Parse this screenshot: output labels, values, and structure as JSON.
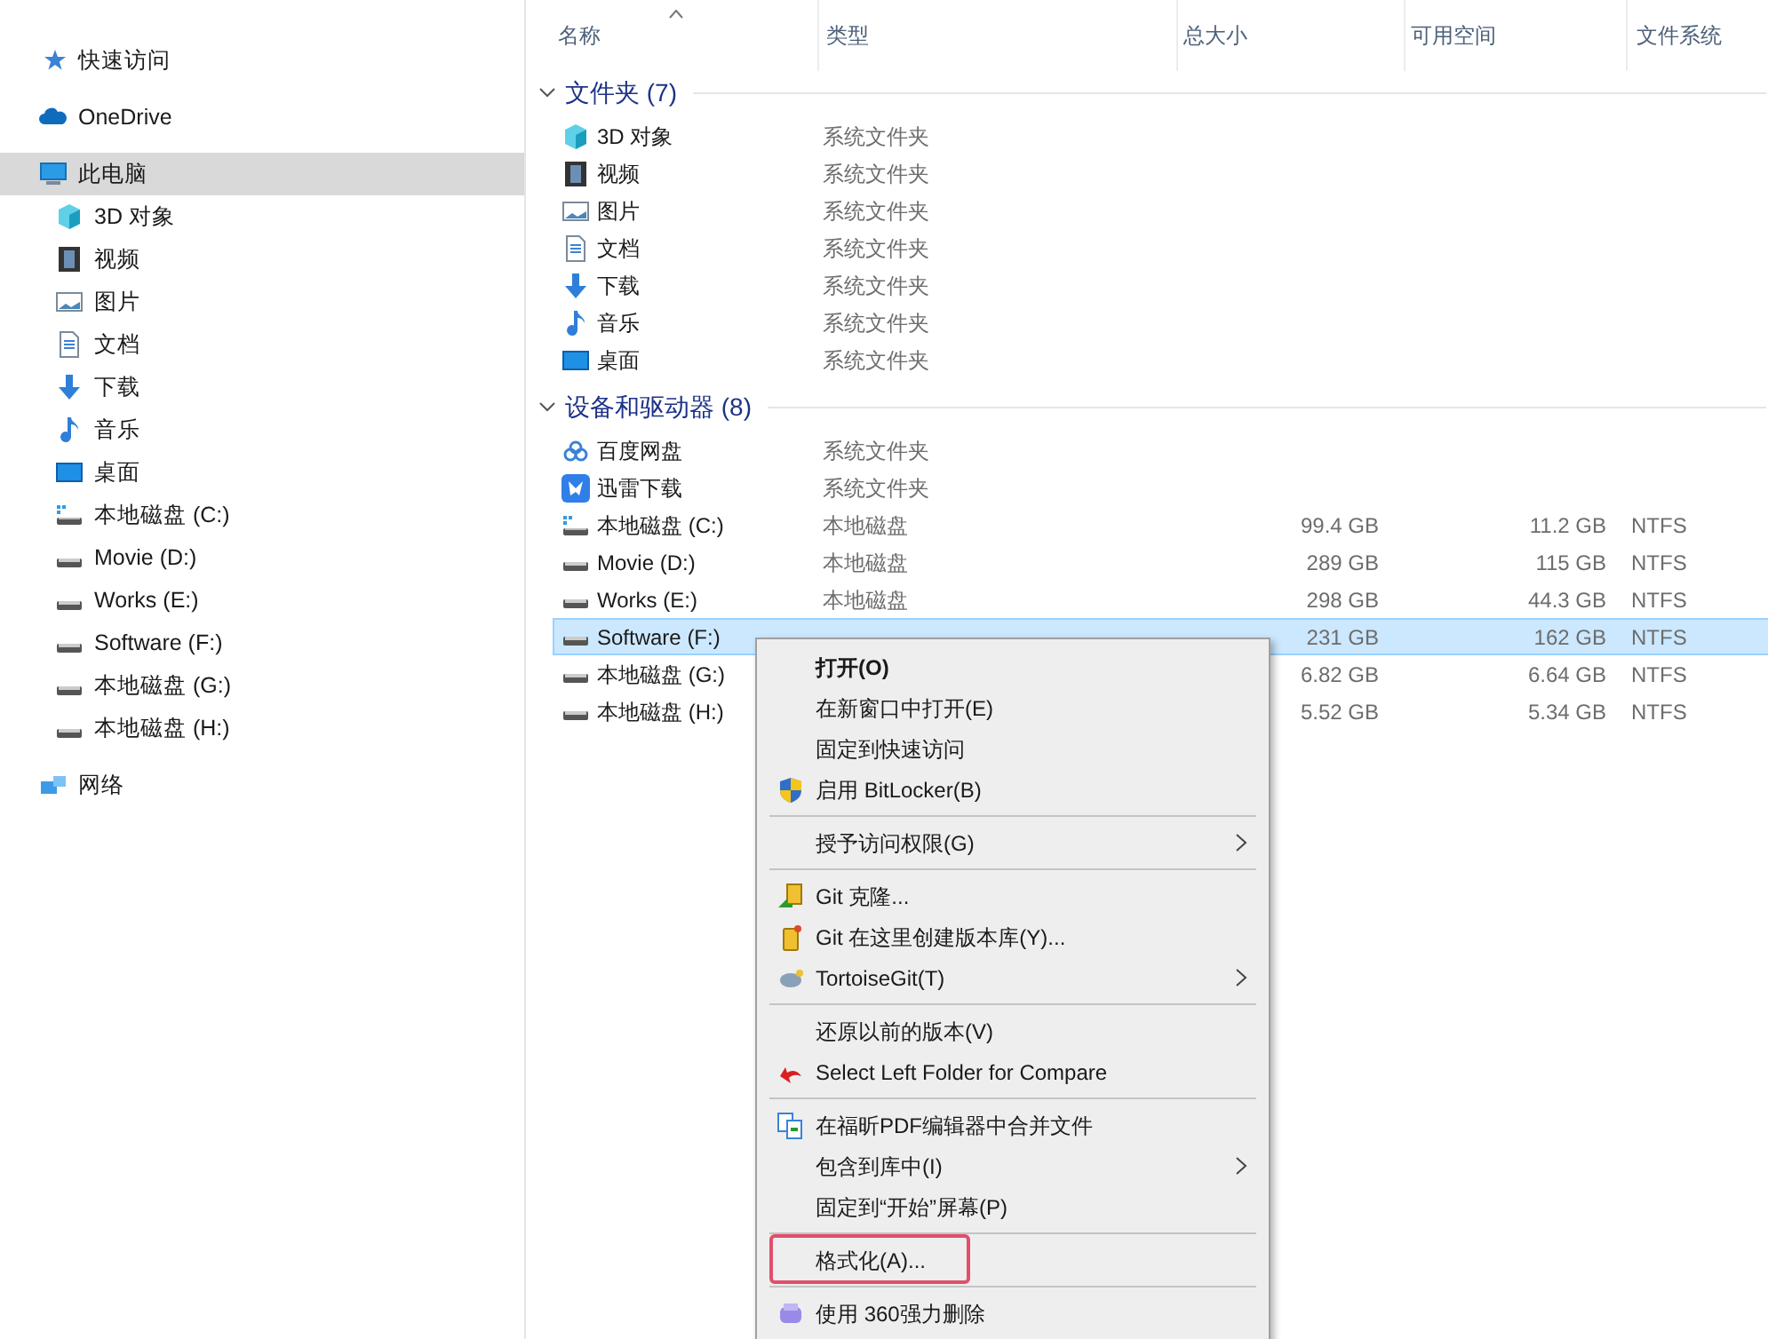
{
  "sidebar": {
    "items": [
      {
        "label": "快速访问",
        "selected": false
      },
      {
        "label": "OneDrive",
        "selected": false
      },
      {
        "label": "此电脑",
        "selected": true,
        "children": [
          {
            "label": "3D 对象",
            "selected": false
          },
          {
            "label": "视频",
            "selected": false
          },
          {
            "label": "图片",
            "selected": false
          },
          {
            "label": "文档",
            "selected": false
          },
          {
            "label": "下载",
            "selected": false
          },
          {
            "label": "音乐",
            "selected": false
          },
          {
            "label": "桌面",
            "selected": false
          },
          {
            "label": "本地磁盘 (C:)",
            "selected": false
          },
          {
            "label": "Movie (D:)",
            "selected": false
          },
          {
            "label": "Works (E:)",
            "selected": false
          },
          {
            "label": "Software (F:)",
            "selected": false
          },
          {
            "label": "本地磁盘 (G:)",
            "selected": false
          },
          {
            "label": "本地磁盘 (H:)",
            "selected": false
          }
        ]
      },
      {
        "label": "网络",
        "selected": false
      }
    ]
  },
  "table": {
    "columns": [
      "名称",
      "类型",
      "总大小",
      "可用空间",
      "文件系统"
    ],
    "groups": [
      {
        "title": "文件夹 (7)",
        "expanded": true,
        "rows": [
          {
            "name": "3D 对象",
            "type": "系统文件夹",
            "selected": false
          },
          {
            "name": "视频",
            "type": "系统文件夹",
            "selected": false
          },
          {
            "name": "图片",
            "type": "系统文件夹",
            "selected": false
          },
          {
            "name": "文档",
            "type": "系统文件夹",
            "selected": false
          },
          {
            "name": "下载",
            "type": "系统文件夹",
            "selected": false
          },
          {
            "name": "音乐",
            "type": "系统文件夹",
            "selected": false
          },
          {
            "name": "桌面",
            "type": "系统文件夹",
            "selected": false
          }
        ]
      },
      {
        "title": "设备和驱动器 (8)",
        "expanded": true,
        "rows": [
          {
            "name": "百度网盘",
            "type": "系统文件夹",
            "selected": false
          },
          {
            "name": "迅雷下载",
            "type": "系统文件夹",
            "selected": false
          },
          {
            "name": "本地磁盘 (C:)",
            "type": "本地磁盘",
            "total": "99.4 GB",
            "free": "11.2 GB",
            "fs": "NTFS",
            "selected": false
          },
          {
            "name": "Movie (D:)",
            "type": "本地磁盘",
            "total": "289 GB",
            "free": "115 GB",
            "fs": "NTFS",
            "selected": false
          },
          {
            "name": "Works (E:)",
            "type": "本地磁盘",
            "total": "298 GB",
            "free": "44.3 GB",
            "fs": "NTFS",
            "selected": false
          },
          {
            "name": "Software (F:)",
            "total": "231 GB",
            "free": "162 GB",
            "fs": "NTFS",
            "selected": true
          },
          {
            "name": "本地磁盘 (G:)",
            "total": "6.82 GB",
            "free": "6.64 GB",
            "fs": "NTFS",
            "selected": false
          },
          {
            "name": "本地磁盘 (H:)",
            "total": "5.52 GB",
            "free": "5.34 GB",
            "fs": "NTFS",
            "selected": false
          }
        ]
      }
    ]
  },
  "context_menu": {
    "items": [
      {
        "kind": "item",
        "label": "打开(O)",
        "bold": true,
        "submenu": false,
        "highlighted": false
      },
      {
        "kind": "item",
        "label": "在新窗口中打开(E)",
        "bold": false,
        "submenu": false,
        "highlighted": false
      },
      {
        "kind": "item",
        "label": "固定到快速访问",
        "bold": false,
        "submenu": false,
        "highlighted": false
      },
      {
        "kind": "item",
        "label": "启用 BitLocker(B)",
        "bold": false,
        "submenu": false,
        "highlighted": false
      },
      {
        "kind": "separator"
      },
      {
        "kind": "item",
        "label": "授予访问权限(G)",
        "bold": false,
        "submenu": true,
        "highlighted": false
      },
      {
        "kind": "separator"
      },
      {
        "kind": "item",
        "label": "Git 克隆...",
        "bold": false,
        "submenu": false,
        "highlighted": false
      },
      {
        "kind": "item",
        "label": "Git 在这里创建版本库(Y)...",
        "bold": false,
        "submenu": false,
        "highlighted": false
      },
      {
        "kind": "item",
        "label": "TortoiseGit(T)",
        "bold": false,
        "submenu": true,
        "highlighted": false
      },
      {
        "kind": "separator"
      },
      {
        "kind": "item",
        "label": "还原以前的版本(V)",
        "bold": false,
        "submenu": false,
        "highlighted": false
      },
      {
        "kind": "item",
        "label": "Select Left Folder for Compare",
        "bold": false,
        "submenu": false,
        "highlighted": false
      },
      {
        "kind": "separator"
      },
      {
        "kind": "item",
        "label": "在福昕PDF编辑器中合并文件",
        "bold": false,
        "submenu": false,
        "highlighted": false
      },
      {
        "kind": "item",
        "label": "包含到库中(I)",
        "bold": false,
        "submenu": true,
        "highlighted": false
      },
      {
        "kind": "item",
        "label": "固定到“开始”屏幕(P)",
        "bold": false,
        "submenu": false,
        "highlighted": false
      },
      {
        "kind": "separator"
      },
      {
        "kind": "item",
        "label": "格式化(A)...",
        "bold": false,
        "submenu": false,
        "highlighted": true
      },
      {
        "kind": "separator"
      },
      {
        "kind": "item",
        "label": "使用 360强力删除",
        "bold": false,
        "submenu": false,
        "highlighted": false
      }
    ]
  }
}
